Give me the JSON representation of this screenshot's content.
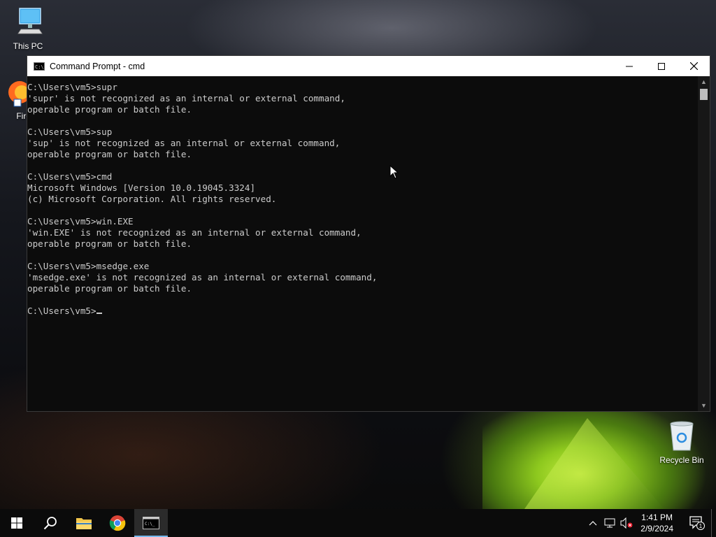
{
  "desktop": {
    "icons": [
      {
        "label": "This PC"
      },
      {
        "label": "Fire"
      },
      {
        "label": "Recycle Bin"
      }
    ]
  },
  "window": {
    "title": "Command Prompt - cmd",
    "icon": "console-icon",
    "icon_text": "C:\\",
    "buttons": {
      "minimize": "—",
      "maximize": "☐",
      "close": "✕"
    }
  },
  "console": {
    "lines": [
      "C:\\Users\\vm5>supr",
      "'supr' is not recognized as an internal or external command,",
      "operable program or batch file.",
      "",
      "C:\\Users\\vm5>sup",
      "'sup' is not recognized as an internal or external command,",
      "operable program or batch file.",
      "",
      "C:\\Users\\vm5>cmd",
      "Microsoft Windows [Version 10.0.19045.3324]",
      "(c) Microsoft Corporation. All rights reserved.",
      "",
      "C:\\Users\\vm5>win.EXE",
      "'win.EXE' is not recognized as an internal or external command,",
      "operable program or batch file.",
      "",
      "C:\\Users\\vm5>msedge.exe",
      "'msedge.exe' is not recognized as an internal or external command,",
      "operable program or batch file.",
      "",
      "C:\\Users\\vm5>"
    ],
    "colors": {
      "background": "#0c0c0c",
      "text": "#cccccc"
    }
  },
  "taskbar": {
    "items": [
      {
        "name": "start-button",
        "icon": "windows-logo-icon"
      },
      {
        "name": "search-button",
        "icon": "search-icon"
      },
      {
        "name": "file-explorer-button",
        "icon": "folder-icon"
      },
      {
        "name": "chrome-button",
        "icon": "chrome-icon"
      },
      {
        "name": "command-prompt-button",
        "icon": "console-icon",
        "active": true
      }
    ],
    "tray": {
      "time": "1:41 PM",
      "date": "2/9/2024",
      "notification_count": "1"
    },
    "accent": "#76b9ed"
  }
}
